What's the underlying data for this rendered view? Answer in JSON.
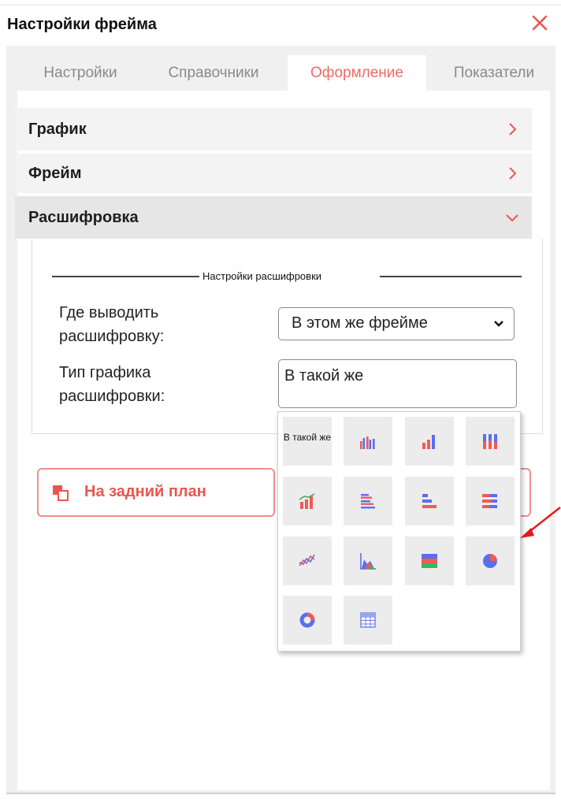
{
  "dialog": {
    "title": "Настройки фрейма"
  },
  "tabs": [
    {
      "label": "Настройки",
      "active": false
    },
    {
      "label": "Справочники",
      "active": false
    },
    {
      "label": "Оформление",
      "active": true
    },
    {
      "label": "Показатели",
      "active": false
    }
  ],
  "sections": [
    {
      "label": "График",
      "expanded": false
    },
    {
      "label": "Фрейм",
      "expanded": false
    },
    {
      "label": "Расшифровка",
      "expanded": true
    }
  ],
  "drilldown": {
    "group_title": "Настройки расшифровки",
    "output_label": "Где выводить расшифровку:",
    "output_value": "В этом же фрейме",
    "chart_type_label": "Тип графика расшифровки:",
    "chart_type_value": "В такой же"
  },
  "buttons": {
    "send_to_back": "На задний план"
  },
  "chart_type_options": [
    {
      "label": "В такой же",
      "icon": "same-text"
    },
    {
      "label": "",
      "icon": "clustered-column-icon"
    },
    {
      "label": "",
      "icon": "column-icon"
    },
    {
      "label": "",
      "icon": "stacked-column-icon"
    },
    {
      "label": "",
      "icon": "column-line-combo-icon"
    },
    {
      "label": "",
      "icon": "clustered-bar-icon"
    },
    {
      "label": "",
      "icon": "bar-icon"
    },
    {
      "label": "",
      "icon": "stacked-bar-icon"
    },
    {
      "label": "",
      "icon": "line-icon"
    },
    {
      "label": "",
      "icon": "area-icon"
    },
    {
      "label": "",
      "icon": "stacked-area-icon"
    },
    {
      "label": "",
      "icon": "pie-icon"
    },
    {
      "label": "",
      "icon": "donut-icon"
    },
    {
      "label": "",
      "icon": "table-icon"
    }
  ],
  "colors": {
    "accent": "#e8574f",
    "series_red": "#ef5b5b",
    "series_blue": "#5a6ff0",
    "series_green": "#3fb25a"
  }
}
